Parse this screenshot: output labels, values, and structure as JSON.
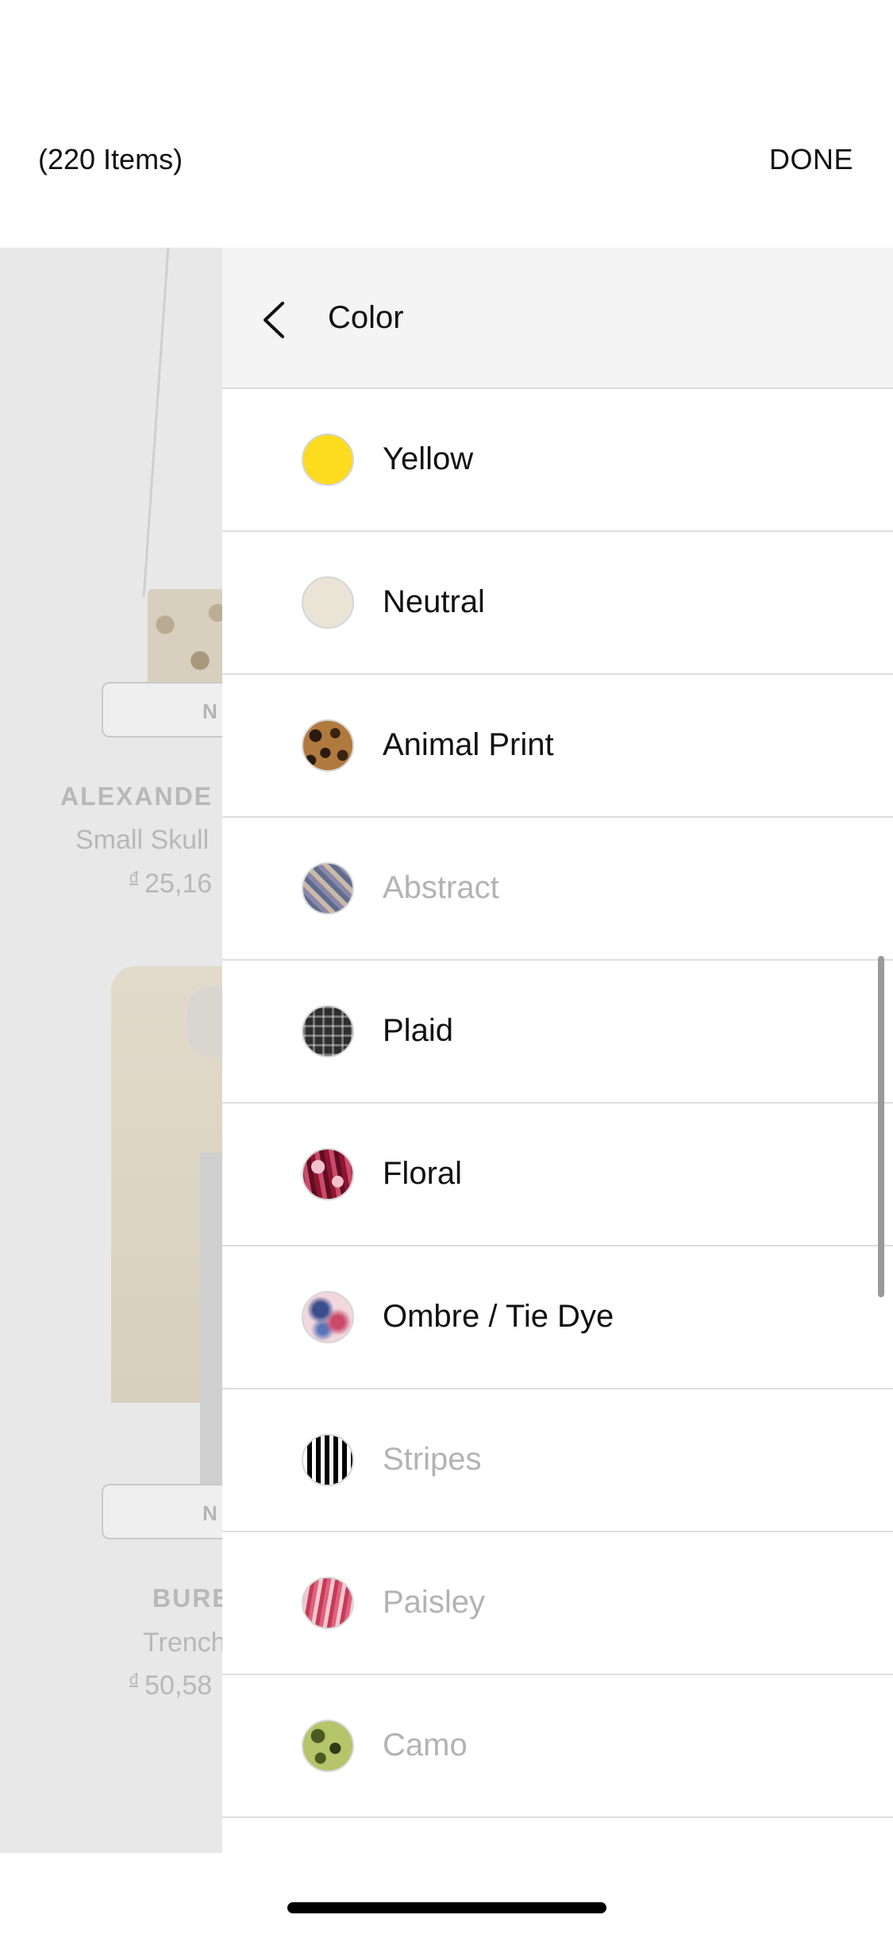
{
  "header": {
    "item_count": "(220 Items)",
    "done_label": "DONE"
  },
  "background_list": {
    "products": [
      {
        "badge": "N",
        "brand": "ALEXANDE",
        "description": "Small Skull",
        "currency": "đ",
        "price": "25,16"
      },
      {
        "badge": "N",
        "brand": "BURE",
        "description": "Trench",
        "currency": "đ",
        "price": "50,58"
      }
    ]
  },
  "filter_panel": {
    "title": "Color",
    "back_icon": "chevron-left-icon",
    "options": [
      {
        "label": "Yellow",
        "swatch": "solid",
        "color": "#FDDB1E",
        "enabled": true
      },
      {
        "label": "Neutral",
        "swatch": "solid",
        "color": "#E9E4D6",
        "enabled": true
      },
      {
        "label": "Animal Print",
        "swatch": "animal-print",
        "enabled": true
      },
      {
        "label": "Abstract",
        "swatch": "abstract",
        "enabled": false
      },
      {
        "label": "Plaid",
        "swatch": "plaid",
        "enabled": true
      },
      {
        "label": "Floral",
        "swatch": "floral",
        "enabled": true
      },
      {
        "label": "Ombre / Tie Dye",
        "swatch": "ombre",
        "enabled": true
      },
      {
        "label": "Stripes",
        "swatch": "stripes",
        "enabled": false
      },
      {
        "label": "Paisley",
        "swatch": "paisley",
        "enabled": false
      },
      {
        "label": "Camo",
        "swatch": "camo",
        "enabled": false
      }
    ]
  }
}
